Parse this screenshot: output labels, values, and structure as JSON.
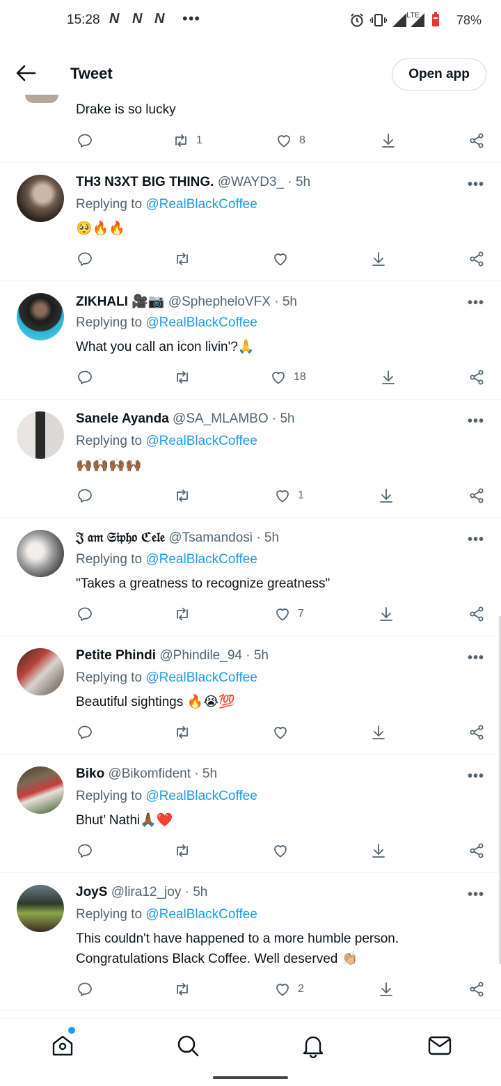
{
  "status_bar": {
    "time": "15:28",
    "notif_icons": [
      "N",
      "N",
      "N"
    ],
    "more": "•••",
    "battery": "78%"
  },
  "header": {
    "title": "Tweet",
    "open_app": "Open app"
  },
  "partial_tweet": {
    "text": "Drake is so lucky",
    "retweets": "1",
    "likes": "8"
  },
  "tweets": [
    {
      "name": "TH3 N3XT BIG THING.",
      "handle": "@WAYD3_",
      "time": "5h",
      "replying_prefix": "Replying to ",
      "replying_to": "@RealBlackCoffee",
      "text": "🥺🔥🔥",
      "likes": ""
    },
    {
      "name": "ZIKHALI 🎥📷",
      "handle": "@SphepheloVFX",
      "time": "5h",
      "replying_prefix": "Replying to ",
      "replying_to": "@RealBlackCoffee",
      "text": "What you call an icon livin'?🙏",
      "likes": "18"
    },
    {
      "name": "Sanele Ayanda",
      "handle": "@SA_MLAMBO",
      "time": "5h",
      "replying_prefix": "Replying to ",
      "replying_to": "@RealBlackCoffee",
      "text": "🙌🏾🙌🏾🙌🏾🙌🏾",
      "likes": "1"
    },
    {
      "name": "𝔍 𝔞𝔪 𝔖𝔦𝔭𝔥𝔬 ℭ𝔢𝔩𝔢",
      "handle": "@Tsamandosi",
      "time": "5h",
      "replying_prefix": "Replying to ",
      "replying_to": "@RealBlackCoffee",
      "text": "\"Takes a greatness to recognize greatness\"",
      "likes": "7"
    },
    {
      "name": "Petite Phindi",
      "handle": "@Phindile_94",
      "time": "5h",
      "replying_prefix": "Replying to ",
      "replying_to": "@RealBlackCoffee",
      "text": "Beautiful sightings 🔥😭💯",
      "likes": ""
    },
    {
      "name": "Biko",
      "handle": "@Bikomfident",
      "time": "5h",
      "replying_prefix": "Replying to ",
      "replying_to": "@RealBlackCoffee",
      "text": "Bhut’ Nathi🙏🏾❤️",
      "likes": ""
    },
    {
      "name": "JoyS",
      "handle": "@lira12_joy",
      "time": "5h",
      "replying_prefix": "Replying to ",
      "replying_to": "@RealBlackCoffee",
      "text": "This couldn't have happened to a more humble person. Congratulations Black Coffee.  Well deserved 👏🏼",
      "likes": "2"
    }
  ],
  "bottom_nav": [
    "home-icon",
    "search-icon",
    "notifications-icon",
    "messages-icon"
  ],
  "colors": {
    "accent": "#1d9bf0",
    "secondary_text": "#536471",
    "primary_text": "#0f1419"
  }
}
